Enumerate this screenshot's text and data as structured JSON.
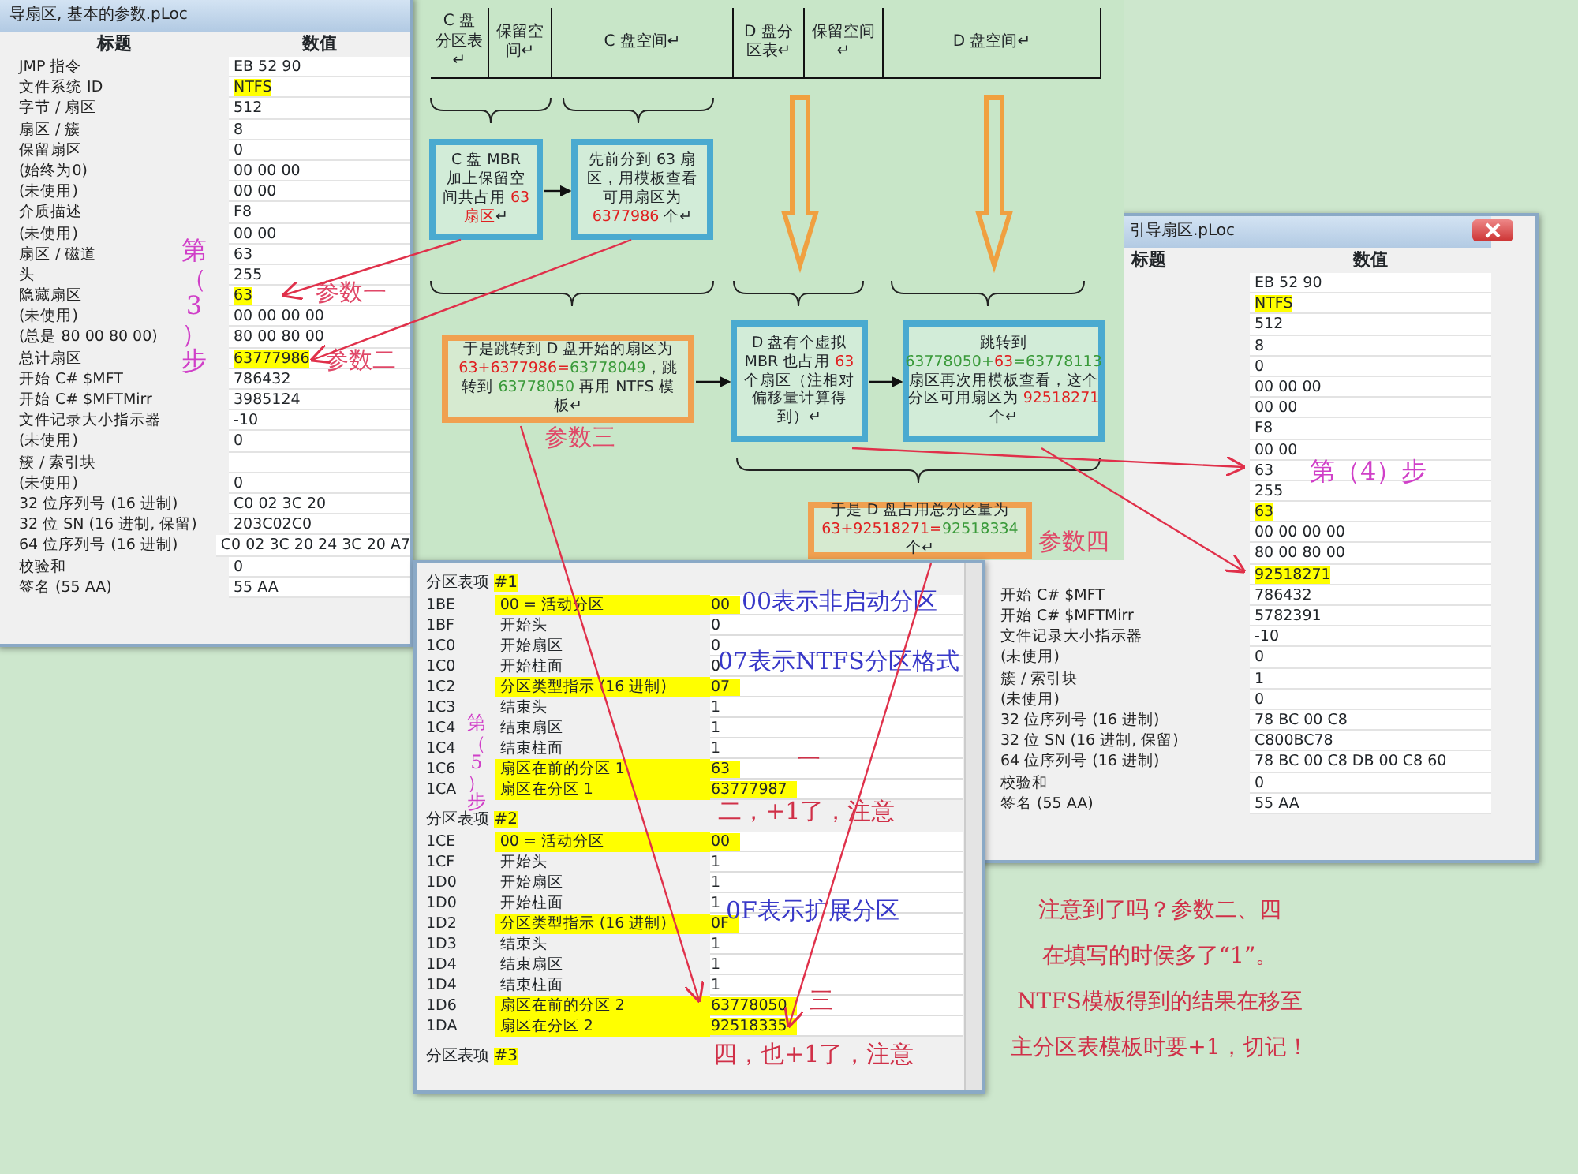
{
  "left_window": {
    "title": "导扇区, 基本的参数.pLoc",
    "columns": [
      "标题",
      "数值"
    ],
    "rows": [
      {
        "label": "JMP 指令",
        "value": "EB 52 90",
        "highlighted": false
      },
      {
        "label": "文件系统 ID",
        "value": "NTFS",
        "highlighted": true
      },
      {
        "label": "字节 / 扇区",
        "value": "512",
        "highlighted": false
      },
      {
        "label": "扇区 / 簇",
        "value": "8",
        "highlighted": false
      },
      {
        "label": "保留扇区",
        "value": "0",
        "highlighted": false
      },
      {
        "label": "(始终为0)",
        "value": "00 00 00",
        "highlighted": false
      },
      {
        "label": "(未使用)",
        "value": "00 00",
        "highlighted": false
      },
      {
        "label": "介质描述",
        "value": "F8",
        "highlighted": false
      },
      {
        "label": "(未使用)",
        "value": "00 00",
        "highlighted": false
      },
      {
        "label": "扇区 / 磁道",
        "value": "63",
        "highlighted": false
      },
      {
        "label": "头",
        "value": "255",
        "highlighted": false
      },
      {
        "label": "隐藏扇区",
        "value": "63",
        "highlighted": true
      },
      {
        "label": "(未使用)",
        "value": "00 00 00 00",
        "highlighted": false
      },
      {
        "label": "(总是 80 00 80 00)",
        "value": "80 00 80 00",
        "highlighted": false
      },
      {
        "label": "总计扇区",
        "value": "63777986",
        "highlighted": true
      },
      {
        "label": "开始 C# $MFT",
        "value": "786432",
        "highlighted": false
      },
      {
        "label": "开始 C# $MFTMirr",
        "value": "3985124",
        "highlighted": false
      },
      {
        "label": "文件记录大小指示器",
        "value": "-10",
        "highlighted": false
      },
      {
        "label": "(未使用)",
        "value": "0",
        "highlighted": false
      },
      {
        "label": "簇 / 索引块",
        "highlighted": false
      },
      {
        "label": "(未使用)",
        "value": "0",
        "highlighted": false
      },
      {
        "label": "32 位序列号 (16 进制)",
        "value": "C0 02 3C 20",
        "highlighted": false
      },
      {
        "label": "32 位 SN (16 进制, 保留)",
        "value": "203C02C0",
        "highlighted": false
      },
      {
        "label": "64 位序列号 (16 进制)",
        "value": "C0 02 3C 20 24 3C 20 A7",
        "highlighted": false
      },
      {
        "label": "校验和",
        "value": "0",
        "highlighted": false
      },
      {
        "label": "签名 (55 AA)",
        "value": "55 AA",
        "highlighted": false
      }
    ]
  },
  "right_window": {
    "title": "引导扇区.pLoc",
    "columns": [
      "标题",
      "数值"
    ],
    "rows": [
      {
        "value": "EB 52 90",
        "highlighted": false
      },
      {
        "value": "NTFS",
        "highlighted": true
      },
      {
        "value": "512",
        "highlighted": false
      },
      {
        "value": "8",
        "highlighted": false
      },
      {
        "value": "0",
        "highlighted": false
      },
      {
        "value": "00 00 00",
        "highlighted": false
      },
      {
        "value": "00 00",
        "highlighted": false
      },
      {
        "value": "F8",
        "highlighted": false
      },
      {
        "value": "00 00",
        "highlighted": false
      },
      {
        "value": "63",
        "highlighted": false
      },
      {
        "value": "255",
        "highlighted": false
      },
      {
        "value": "63",
        "highlighted": true
      },
      {
        "value": "00 00 00 00",
        "highlighted": false
      },
      {
        "value": "80 00 80 00",
        "highlighted": false
      },
      {
        "value": "92518271",
        "highlighted": true
      },
      {
        "label": "开始 C# $MFT",
        "value": "786432",
        "highlighted": false
      },
      {
        "label": "开始 C# $MFTMirr",
        "value": "5782391",
        "highlighted": false
      },
      {
        "label": "文件记录大小指示器",
        "value": "-10",
        "highlighted": false
      },
      {
        "label": "(未使用)",
        "value": "0",
        "highlighted": false
      },
      {
        "label": "簇 / 索引块",
        "value": "1",
        "highlighted": false
      },
      {
        "label": "(未使用)",
        "value": "0",
        "highlighted": false
      },
      {
        "label": "32 位序列号 (16 进制)",
        "value": "78 BC 00 C8",
        "highlighted": false
      },
      {
        "label": "32 位 SN (16 进制, 保留)",
        "value": "C800BC78",
        "highlighted": false
      },
      {
        "label": "64 位序列号 (16 进制)",
        "value": "78 BC 00 C8 DB 00 C8 60",
        "highlighted": false
      },
      {
        "label": "校验和",
        "value": "0",
        "highlighted": false
      },
      {
        "label": "签名 (55 AA)",
        "value": "55 AA",
        "highlighted": false
      }
    ]
  },
  "diagram": {
    "header": [
      "C 盘分区表↵",
      "保留空间↵",
      "C 盘空间↵",
      "D 盘分区表↵",
      "保留空间↵",
      "D 盘空间↵"
    ],
    "boxes": [
      {
        "kind": "blue",
        "parts": [
          {
            "text": "C 盘 MBR 加上保留空间共占用 ",
            "kind": "plain"
          },
          {
            "text": "63 扇区",
            "kind": "red"
          },
          {
            "text": "↵",
            "kind": "plain"
          }
        ]
      },
      {
        "kind": "blue",
        "parts": [
          {
            "text": "先前分到 63 扇区，用模板查看可用扇区为 ",
            "kind": "plain"
          },
          {
            "text": "6377986",
            "kind": "red"
          },
          {
            "text": " 个↵",
            "kind": "plain"
          }
        ]
      },
      {
        "kind": "orange",
        "parts": [
          {
            "text": "于是跳转到 D 盘开始的扇区为 ",
            "kind": "plain"
          },
          {
            "text": "63+6377986=",
            "kind": "red"
          },
          {
            "text": "63778049",
            "kind": "green"
          },
          {
            "text": "，跳转到 ",
            "kind": "plain"
          },
          {
            "text": "63778050",
            "kind": "green"
          },
          {
            "text": " 再用 NTFS 模板↵",
            "kind": "plain"
          }
        ]
      },
      {
        "kind": "blue",
        "parts": [
          {
            "text": "D 盘有个虚拟 MBR 也占用 ",
            "kind": "plain"
          },
          {
            "text": "63",
            "kind": "red"
          },
          {
            "text": " 个扇区（注相对偏移量计算得到）↵",
            "kind": "plain"
          }
        ]
      },
      {
        "kind": "blue",
        "parts": [
          {
            "text": "跳转到 ",
            "kind": "plain"
          },
          {
            "text": "63778050+",
            "kind": "green"
          },
          {
            "text": "63",
            "kind": "red"
          },
          {
            "text": "=63778113",
            "kind": "green"
          },
          {
            "text": " 扇区再次用模板查看，这个分区可用扇区为 ",
            "kind": "plain"
          },
          {
            "text": "92518271",
            "kind": "red"
          },
          {
            "text": " 个↵",
            "kind": "plain"
          }
        ]
      },
      {
        "kind": "orange",
        "parts": [
          {
            "text": "于是 D 盘占用总分区量为 ",
            "kind": "plain"
          },
          {
            "text": "63+92518271=",
            "kind": "red"
          },
          {
            "text": "92518334",
            "kind": "green"
          },
          {
            "text": " 个↵",
            "kind": "plain"
          }
        ]
      }
    ]
  },
  "partition_window": {
    "entries": [
      {
        "title": "分区表项",
        "number": "#1",
        "rows": [
          {
            "offset": "1BE",
            "label": "00 = 活动分区",
            "value": "00",
            "highlighted": true
          },
          {
            "offset": "1BF",
            "label": "开始头",
            "value": "0",
            "highlighted": false
          },
          {
            "offset": "1C0",
            "label": "开始扇区",
            "value": "0",
            "highlighted": false
          },
          {
            "offset": "1C0",
            "label": "开始柱面",
            "value": "0",
            "highlighted": false
          },
          {
            "offset": "1C2",
            "label": "分区类型指示 (16 进制)",
            "value": "07",
            "highlighted": true
          },
          {
            "offset": "1C3",
            "label": "结束头",
            "value": "1",
            "highlighted": false
          },
          {
            "offset": "1C4",
            "label": "结束扇区",
            "value": "1",
            "highlighted": false
          },
          {
            "offset": "1C4",
            "label": "结束柱面",
            "value": "1",
            "highlighted": false
          },
          {
            "offset": "1C6",
            "label": "扇区在前的分区 1",
            "value": "63",
            "highlighted": true
          },
          {
            "offset": "1CA",
            "label": "扇区在分区 1",
            "value": "63777987",
            "highlighted": true
          }
        ]
      },
      {
        "title": "分区表项",
        "number": "#2",
        "rows": [
          {
            "offset": "1CE",
            "label": "00 = 活动分区",
            "value": "00",
            "highlighted": true
          },
          {
            "offset": "1CF",
            "label": "开始头",
            "value": "1",
            "highlighted": false
          },
          {
            "offset": "1D0",
            "label": "开始扇区",
            "value": "1",
            "highlighted": false
          },
          {
            "offset": "1D0",
            "label": "开始柱面",
            "value": "1",
            "highlighted": false
          },
          {
            "offset": "1D2",
            "label": "分区类型指示 (16 进制)",
            "value": "0F",
            "highlighted": true
          },
          {
            "offset": "1D3",
            "label": "结束头",
            "value": "1",
            "highlighted": false
          },
          {
            "offset": "1D4",
            "label": "结束扇区",
            "value": "1",
            "highlighted": false
          },
          {
            "offset": "1D4",
            "label": "结束柱面",
            "value": "1",
            "highlighted": false
          },
          {
            "offset": "1D6",
            "label": "扇区在前的分区 2",
            "value": "63778050",
            "highlighted": true
          },
          {
            "offset": "1DA",
            "label": "扇区在分区 2",
            "value": "92518335",
            "highlighted": true
          }
        ]
      },
      {
        "title": "分区表项",
        "number": "#3"
      }
    ]
  },
  "annotations": [
    {
      "text": "第（3）步",
      "kind": "step"
    },
    {
      "text": "参数一",
      "kind": "param"
    },
    {
      "text": "参数二",
      "kind": "param"
    },
    {
      "text": "参数三",
      "kind": "param"
    },
    {
      "text": "参数四",
      "kind": "param"
    },
    {
      "text": "第（4）步",
      "kind": "step-inline"
    },
    {
      "text": "00表示非启动分区",
      "kind": "remark"
    },
    {
      "text": "07表示NTFS分区格式",
      "kind": "remark"
    },
    {
      "text": "第（5）步",
      "kind": "step"
    },
    {
      "text": "一",
      "kind": "red-remark"
    },
    {
      "text": "二，+1了，注意",
      "kind": "red-remark"
    },
    {
      "text": "0F表示扩展分区",
      "kind": "remark"
    },
    {
      "text": "三",
      "kind": "red-remark"
    },
    {
      "text": "四，也+1了，注意",
      "kind": "red-remark"
    }
  ],
  "note": {
    "lines": [
      "注意到了吗？参数二、四",
      "在填写的时侯多了“1”。",
      "NTFS模板得到的结果在移至",
      "主分区表模板时要+1，切记！"
    ]
  }
}
